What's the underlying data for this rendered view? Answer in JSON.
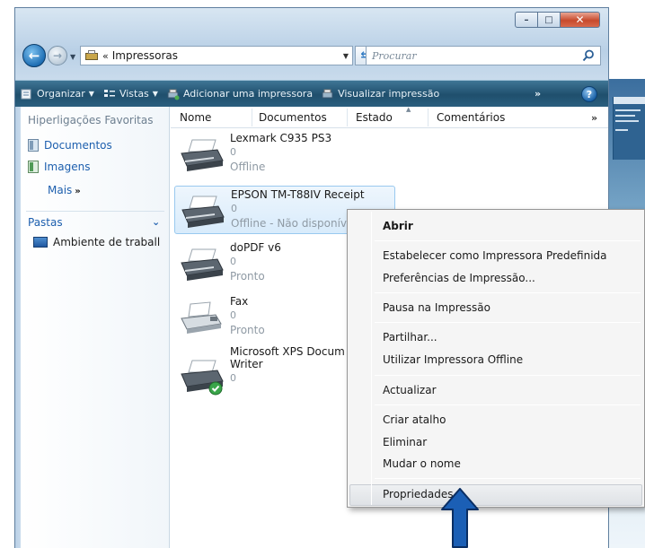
{
  "window": {
    "address_chevron": "«",
    "address_path": "Impressoras",
    "search_placeholder": "Procurar",
    "caption_buttons": {
      "minimize": "–",
      "maximize": "□",
      "close": "✕"
    }
  },
  "toolbar": {
    "items": [
      {
        "label": "Organizar",
        "has_dropdown": true
      },
      {
        "label": "Vistas",
        "has_dropdown": true
      },
      {
        "label": "Adicionar uma impressora",
        "has_dropdown": false
      },
      {
        "label": "Visualizar impressão",
        "has_dropdown": false
      }
    ],
    "more": "»",
    "help": "?"
  },
  "sidebar": {
    "favorites_heading": "Hiperligações Favoritas",
    "favorites": [
      {
        "label": "Documentos",
        "icon": "documents-icon"
      },
      {
        "label": "Imagens",
        "icon": "pictures-icon"
      }
    ],
    "more_label": "Mais",
    "more_chevron": "»",
    "folders_label": "Pastas",
    "folders_chevron": "⌄",
    "tree_item": "Ambiente de traball"
  },
  "columns": {
    "headers": [
      "Nome",
      "Documentos",
      "Estado",
      "Comentários"
    ],
    "more": "»"
  },
  "printers": [
    {
      "name": "Lexmark C935 PS3",
      "docs": "0",
      "state": "Offline",
      "selected": false,
      "icon": "printer-icon"
    },
    {
      "name": "EPSON TM-T88IV Receipt",
      "docs": "0",
      "state": "Offline - Não disponív",
      "selected": true,
      "icon": "printer-icon"
    },
    {
      "name": "doPDF v6",
      "docs": "0",
      "state": "Pronto",
      "selected": false,
      "icon": "printer-icon"
    },
    {
      "name": "Fax",
      "docs": "0",
      "state": "Pronto",
      "selected": false,
      "icon": "fax-icon"
    },
    {
      "name": "Microsoft XPS Docum",
      "name2": "Writer",
      "docs": "0",
      "state": "",
      "selected": false,
      "icon": "default-printer-icon"
    }
  ],
  "context_menu": {
    "items": [
      {
        "label": "Abrir",
        "bold": true
      },
      {
        "label": "Estabelecer como Impressora Predefinida"
      },
      {
        "label": "Preferências de Impressão..."
      },
      {
        "label": "Pausa na Impressão"
      },
      {
        "label": "Partilhar..."
      },
      {
        "label": "Utilizar Impressora Offline"
      },
      {
        "label": "Actualizar"
      },
      {
        "label": "Criar atalho"
      },
      {
        "label": "Eliminar"
      },
      {
        "label": "Mudar o nome"
      },
      {
        "label": "Propriedades",
        "highlighted": true
      }
    ]
  },
  "colors": {
    "toolbar": "#1f4f6d",
    "link": "#1d5fae",
    "selection": "#d8ebfb",
    "arrow": "#1b5fb5"
  }
}
